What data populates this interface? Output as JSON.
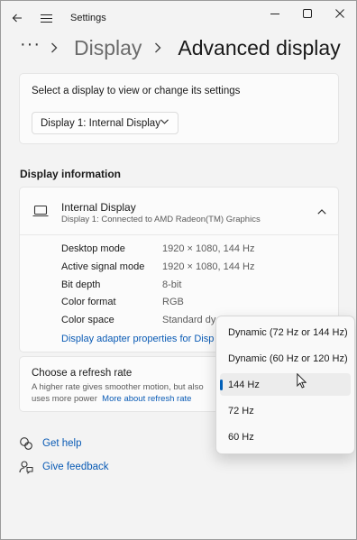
{
  "app": {
    "title": "Settings"
  },
  "breadcrumb": {
    "more": "···",
    "parent": "Display",
    "current": "Advanced display"
  },
  "select_display": {
    "label": "Select a display to view or change its settings",
    "selected": "Display 1: Internal Display"
  },
  "display_info": {
    "section_title": "Display information",
    "name": "Internal Display",
    "subtitle": "Display 1: Connected to AMD Radeon(TM) Graphics",
    "rows": [
      {
        "key": "Desktop mode",
        "value": "1920 × 1080, 144 Hz"
      },
      {
        "key": "Active signal mode",
        "value": "1920 × 1080, 144 Hz"
      },
      {
        "key": "Bit depth",
        "value": "8-bit"
      },
      {
        "key": "Color format",
        "value": "RGB"
      },
      {
        "key": "Color space",
        "value": "Standard dy"
      }
    ],
    "adapter_link": "Display adapter properties for Disp"
  },
  "refresh": {
    "title": "Choose a refresh rate",
    "desc_line1": "A higher rate gives smoother motion, but also",
    "desc_line2": "uses more power",
    "link": "More about refresh rate"
  },
  "help": {
    "get_help": "Get help",
    "feedback": "Give feedback"
  },
  "refresh_menu": {
    "items": [
      "Dynamic (72 Hz or 144 Hz)",
      "Dynamic (60 Hz or 120 Hz)",
      "144 Hz",
      "72 Hz",
      "60 Hz"
    ],
    "selected": "144 Hz"
  },
  "colors": {
    "accent": "#0a5bb5",
    "selection_bar": "#005fb8"
  }
}
